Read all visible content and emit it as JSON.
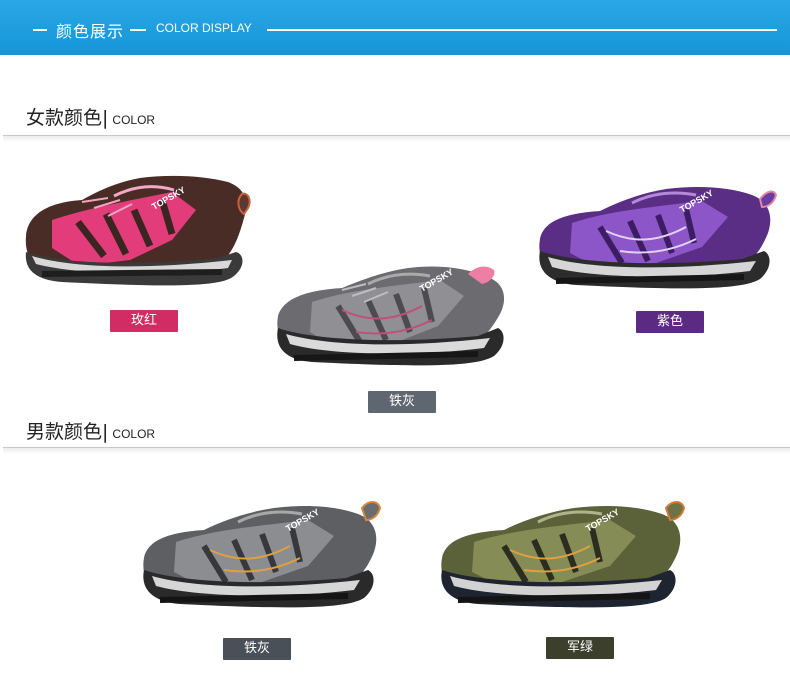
{
  "banner": {
    "title_cn": "颜色展示",
    "title_en": "COLOR DISPLAY",
    "bg_color": "#1b9ee0"
  },
  "women": {
    "title_cn": "女款颜色|",
    "title_en": "COLOR",
    "items": [
      {
        "label": "玫红",
        "tag_color": "#d12d64",
        "brand": "TOPSKY"
      },
      {
        "label": "铁灰",
        "tag_color": "#5e6670",
        "brand": "TOPSKY"
      },
      {
        "label": "紫色",
        "tag_color": "#5b2a83",
        "brand": "TOPSKY"
      }
    ]
  },
  "men": {
    "title_cn": "男款颜色|",
    "title_en": "COLOR",
    "items": [
      {
        "label": "铁灰",
        "tag_color": "#4a5058",
        "brand": "TOPSKY"
      },
      {
        "label": "军绿",
        "tag_color": "#3b3f2c",
        "brand": "TOPSKY"
      }
    ]
  }
}
